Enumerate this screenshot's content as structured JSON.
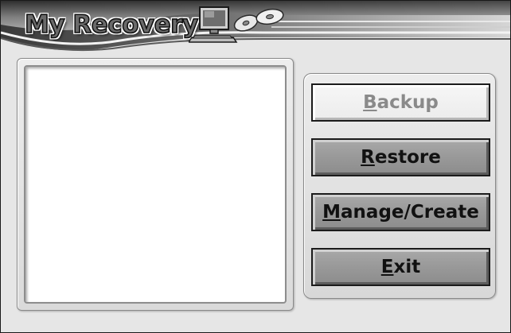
{
  "app": {
    "title": "My Recovery"
  },
  "buttons": {
    "backup": {
      "accel": "B",
      "rest": "ackup",
      "state": "disabled"
    },
    "restore": {
      "accel": "R",
      "rest": "estore"
    },
    "manage": {
      "accel": "M",
      "rest": "anage/Create"
    },
    "exit": {
      "accel": "E",
      "rest": "xit"
    }
  },
  "list": {
    "items": []
  },
  "icons": {
    "logo": "computer-with-discs-icon"
  },
  "colors": {
    "window_bg": "#e6e6e6",
    "button_face": "#9a9a9a",
    "button_disabled_face": "#f0f0f0",
    "button_disabled_text": "#8a8a8a",
    "text": "#111111"
  }
}
